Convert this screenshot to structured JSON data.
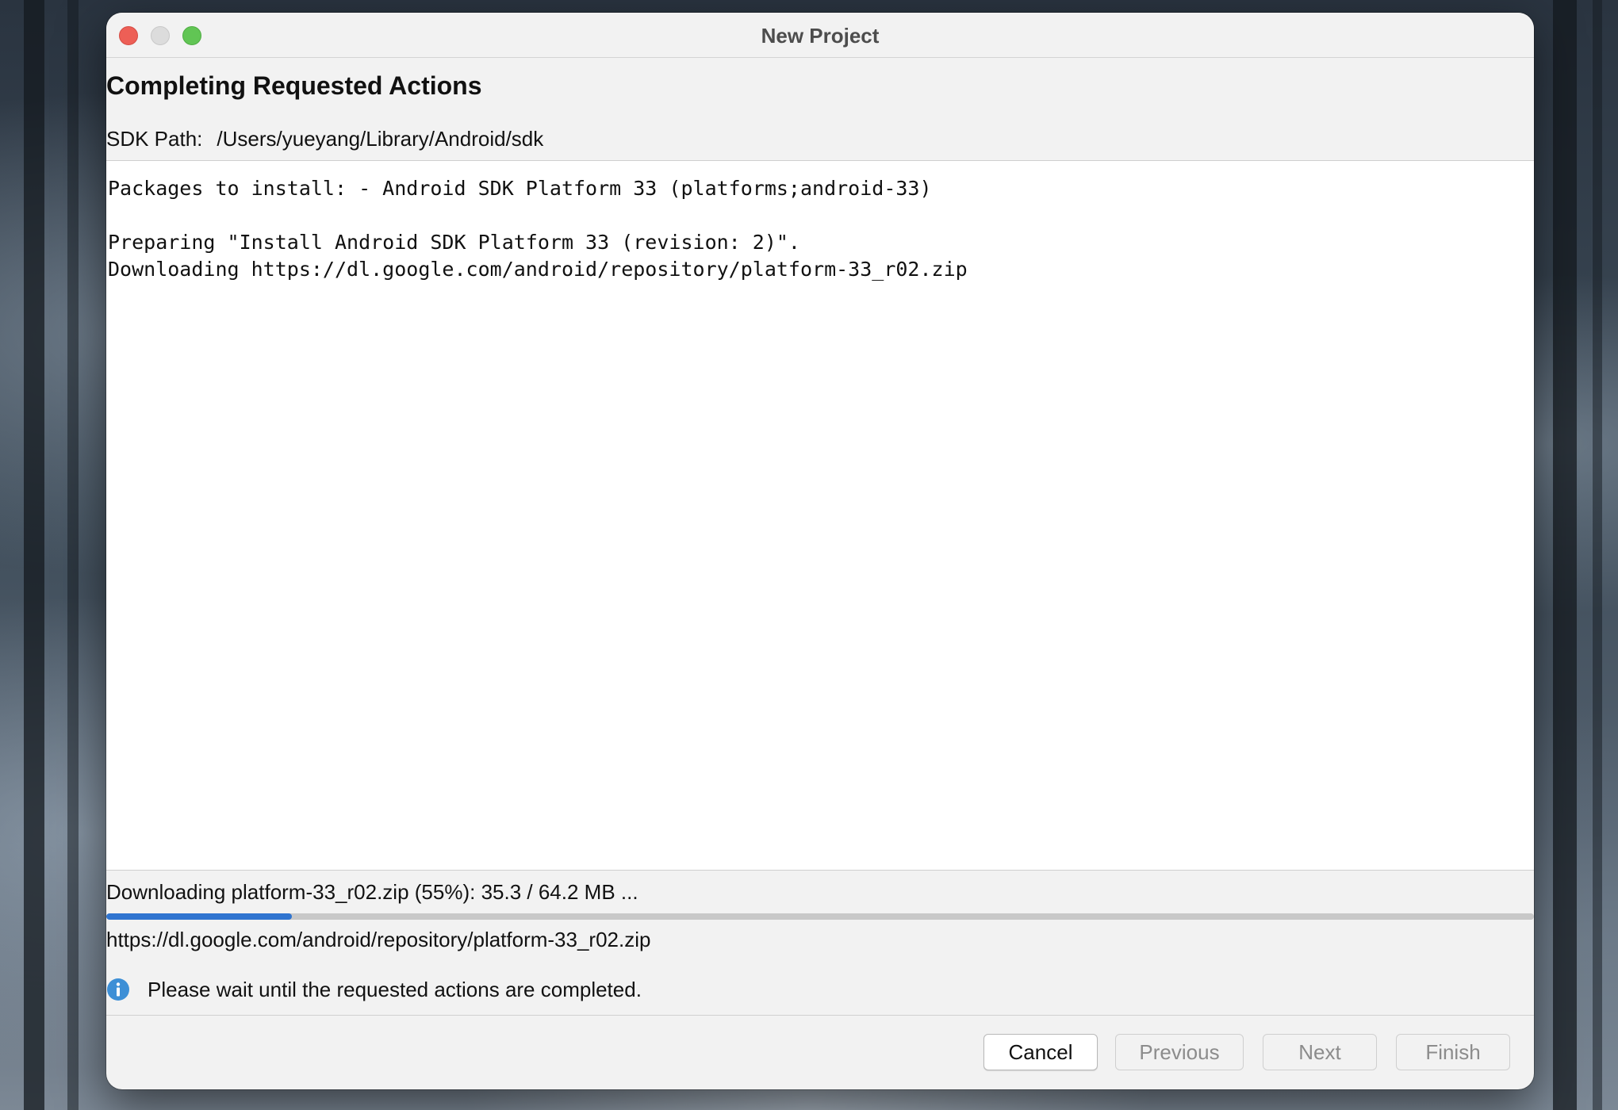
{
  "window": {
    "title": "New Project"
  },
  "wizard": {
    "heading": "Completing Requested Actions",
    "sdk_path_label": "SDK Path:",
    "sdk_path_value": "/Users/yueyang/Library/Android/sdk"
  },
  "log": {
    "line1": "Packages to install: - Android SDK Platform 33 (platforms;android-33)",
    "line2": "Preparing \"Install Android SDK Platform 33 (revision: 2)\".",
    "line3": "Downloading https://dl.google.com/android/repository/platform-33_r02.zip"
  },
  "progress": {
    "status_text": "Downloading platform-33_r02.zip (55%): 35.3 / 64.2 MB ...",
    "bar_fraction": 0.13,
    "bar_color": "#2f74d0",
    "url_text": "https://dl.google.com/android/repository/platform-33_r02.zip"
  },
  "info": {
    "icon": "info-icon",
    "message": "Please wait until the requested actions are completed."
  },
  "buttons": {
    "cancel": "Cancel",
    "previous": "Previous",
    "next": "Next",
    "finish": "Finish"
  }
}
